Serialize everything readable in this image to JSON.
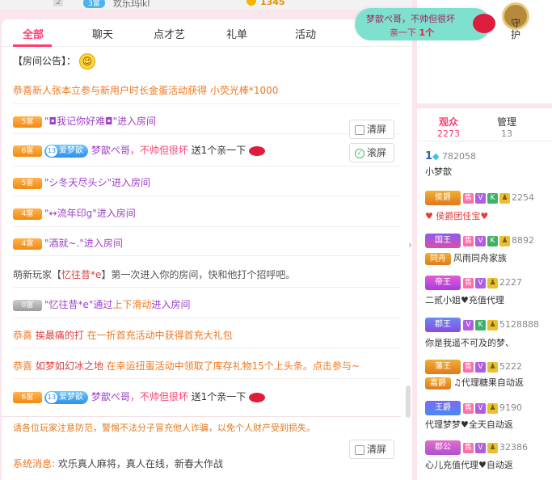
{
  "topstrip": {
    "num": "2",
    "badge": "3富",
    "name": "欢乐玛ikl",
    "coins": "1345"
  },
  "tabs": [
    "全部",
    "聊天",
    "点才艺",
    "礼单",
    "活动"
  ],
  "announcement": "【房间公告】：",
  "messages": {
    "m1": "恭喜新人张本立参与新用户时长金蛋活动获得 小荧光棒*1000",
    "m2": {
      "badge": "5富",
      "text": "\"◘我记你好难◘\"进入房间"
    },
    "m3": {
      "badge": "6富",
      "pill": "爱梦歆",
      "pilllevel": "13",
      "sender": "梦歆ぺ哥",
      "mid": "，不帅但很坏",
      "gift": " 送1个亲一下"
    },
    "m4": {
      "badge": "5富",
      "text": "\"シ冬天尽头シ\"进入房间"
    },
    "m5": {
      "badge": "4富",
      "text": "\"↔流年印g\"进入房间"
    },
    "m6": {
      "badge": "4富",
      "text": "\"酒就~.\"进入房间"
    },
    "m7": {
      "pre": "萌新玩家【",
      "name": "忆往昔*e",
      "post": "】第一次进入你的房间，快和他打个招呼吧。"
    },
    "m8": {
      "badge": "0富",
      "pre": "\"忆往昔*e\"通过",
      "action": "上下滑动",
      "post": "进入房间"
    },
    "m9": {
      "pre": "恭喜 ",
      "name": "挨最痛的打",
      "post": " 在一折首充活动中获得首充大礼包"
    },
    "m10": {
      "pre": "恭喜 ",
      "name": "如梦如幻冰之地",
      "post": " 在幸运扭蛋活动中领取了库存礼物15个上头条。点击参与~"
    },
    "m11": {
      "badge": "6富",
      "pill": "爱梦歆",
      "pilllevel": "13",
      "sender": "梦歆ぺ哥",
      "mid": "，不帅但很坏",
      "gift": " 送1个亲一下"
    }
  },
  "buttons": {
    "clear": "清屏",
    "scroll": "滚屏",
    "clear2": "清屏"
  },
  "warning": "请各位玩家注意防范，警惕不法分子冒充他人诈骗，以免个人财产受到损失。",
  "system": {
    "label": "系统消息:",
    "text": " 欢乐真人麻将，真人在线，新春大作战"
  },
  "toast": {
    "line1": "梦歆ぺ哥，不帅但很坏",
    "line2": "亲一下",
    "count": "1个"
  },
  "guard": "守护",
  "right": {
    "tabs": [
      {
        "label": "观众",
        "count": "2273"
      },
      {
        "label": "管理",
        "count": "13"
      }
    ],
    "users": [
      {
        "rank": "1",
        "score": "782058",
        "name": "小梦歆"
      },
      {
        "crown": "侯爵",
        "score": "2254",
        "name": "♥ 侯爵团佳宝♥ "
      },
      {
        "crown": "国王",
        "sub": "同舟",
        "score": "8892",
        "name": "风雨同舟家族"
      },
      {
        "crown": "帝王",
        "score": "2227",
        "name": "二贰小姐♥充值代理"
      },
      {
        "crown": "郡王",
        "score": "5128888",
        "name": "你是我遥不可及的梦、"
      },
      {
        "crown": "藩王",
        "sub": "嘉爵",
        "score": "5222",
        "name": "♫代理糖果自动返"
      },
      {
        "crown": "王爵",
        "score": "9190",
        "name": "代理梦梦♥全天自动返"
      },
      {
        "crown": "郡公",
        "score": "32386",
        "name": "心儿充值代理♥自动返"
      }
    ],
    "tags": {
      "sell": "售",
      "v": "V",
      "k": "K"
    }
  }
}
